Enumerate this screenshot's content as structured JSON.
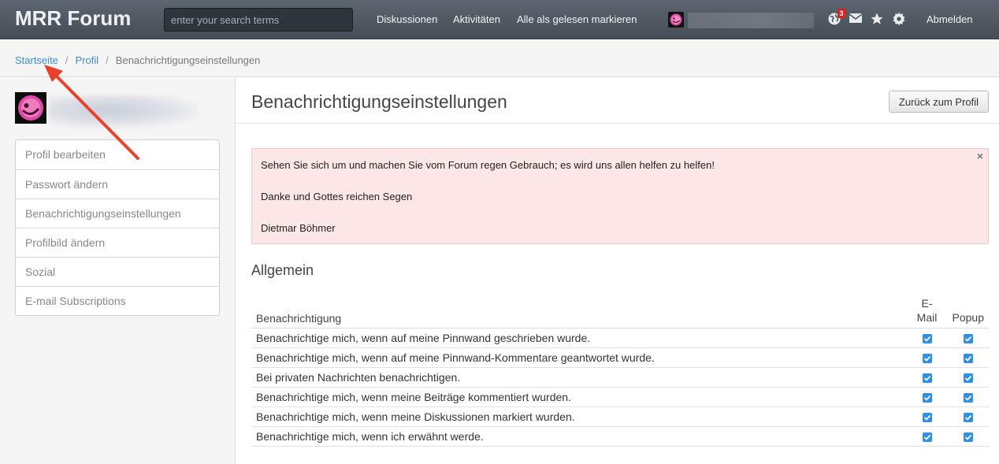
{
  "navbar": {
    "brand": "MRR Forum",
    "search_placeholder": "enter your search terms",
    "links": [
      "Diskussionen",
      "Aktivitäten",
      "Alle als gelesen markieren"
    ],
    "notification_count": "3",
    "logout": "Abmelden"
  },
  "breadcrumb": {
    "home": "Startseite",
    "profile": "Profil",
    "current": "Benachrichtigungseinstellungen",
    "separator": "/"
  },
  "sidebar": {
    "items": [
      "Profil bearbeiten",
      "Passwort ändern",
      "Benachrichtigungseinstellungen",
      "Profilbild ändern",
      "Sozial",
      "E-mail Subscriptions"
    ]
  },
  "main": {
    "title": "Benachrichtigungseinstellungen",
    "back_button": "Zurück zum Profil",
    "alert": {
      "close": "×",
      "lines": [
        "Sehen Sie sich um und machen Sie vom Forum regen Gebrauch; es wird uns allen helfen zu helfen!",
        "Danke und Gottes reichen Segen",
        "Dietmar Böhmer"
      ]
    },
    "section_title": "Allgemein",
    "table": {
      "headers": {
        "label": "Benachrichtigung",
        "email_top": "E-",
        "email_bottom": "Mail",
        "popup": "Popup"
      },
      "rows": [
        {
          "label": "Benachrichtige mich, wenn auf meine Pinnwand geschrieben wurde.",
          "email": true,
          "popup": true
        },
        {
          "label": "Benachrichtige mich, wenn auf meine Pinnwand-Kommentare geantwortet wurde.",
          "email": true,
          "popup": true
        },
        {
          "label": "Bei privaten Nachrichten benachrichtigen.",
          "email": true,
          "popup": true
        },
        {
          "label": "Benachrichtige mich, wenn meine Beiträge kommentiert wurden.",
          "email": true,
          "popup": true
        },
        {
          "label": "Benachrichtige mich, wenn meine Diskussionen markiert wurden.",
          "email": true,
          "popup": true
        },
        {
          "label": "Benachrichtige mich, wenn ich erwähnt werde.",
          "email": true,
          "popup": true
        }
      ]
    }
  },
  "colors": {
    "accent": "#3a8fd6",
    "checkbox": "#2f8fe6",
    "alert_bg": "#fde6e6",
    "annotation_arrow": "#e8412c"
  },
  "icons": [
    "globe-icon",
    "mail-icon",
    "star-icon",
    "gear-icon"
  ]
}
